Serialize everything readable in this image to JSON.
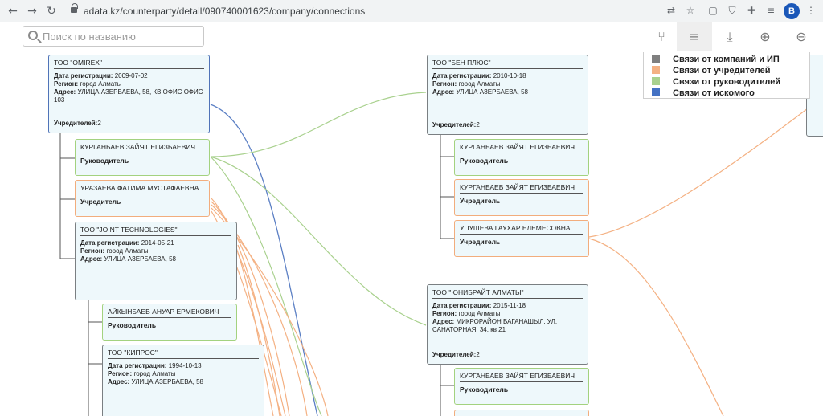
{
  "browser": {
    "url": "adata.kz/counterparty/detail/090740001623/company/connections",
    "profile_initial": "B",
    "back_icon": "arrow-left",
    "forward_icon": "arrow-right",
    "reload_icon": "reload"
  },
  "toolbar": {
    "search_placeholder": "Поиск по названию",
    "buttons": [
      "tree-icon",
      "list-icon",
      "download-icon",
      "zoom-in-icon",
      "zoom-out-icon"
    ]
  },
  "legend": [
    {
      "label": "Связи от компаний и ИП",
      "color": "#7f7f7f"
    },
    {
      "label": "Связи от учредителей",
      "color": "#f4b183"
    },
    {
      "label": "Связи от руководителей",
      "color": "#a9d18e"
    },
    {
      "label": "Связи от искомого",
      "color": "#4472c4"
    }
  ],
  "labels": {
    "reg": "Дата регистрации:",
    "region": "Регион:",
    "address": "Адрес:",
    "founders": "Учредителей:"
  },
  "nodes": {
    "omirex": {
      "title": "ТОО \"OMIREX\"",
      "reg_date": "2009-07-02",
      "region": "город Алматы",
      "address": "УЛИЦА АЗЕРБАЕВА, 58, КВ ОФИС ОФИС 103",
      "founders_count": "2"
    },
    "kurganbaev_1": {
      "name": "КУРГАНБАЕВ ЗАЙЯТ ЕГИЗБАЕВИЧ",
      "role": "Руководитель"
    },
    "urazaeva": {
      "name": "УРАЗАЕВА ФАТИМА МУСТАФАЕВНА",
      "role": "Учредитель"
    },
    "joint": {
      "title": "ТОО \"JOINT TECHNOLOGIES\"",
      "reg_date": "2014-05-21",
      "region": "город Алматы",
      "address": "УЛИЦА АЗЕРБАЕВА, 58"
    },
    "aikynbaev": {
      "name": "АЙКЫНБАЕВ АНУАР ЕРМЕКОВИЧ",
      "role": "Руководитель"
    },
    "kipros": {
      "title": "ТОО \"КИПРОС\"",
      "reg_date": "1994-10-13",
      "region": "город Алматы",
      "address": "УЛИЦА АЗЕРБАЕВА, 58"
    },
    "ben_plus": {
      "title": "ТОО \"БЕН ПЛЮС\"",
      "reg_date": "2010-10-18",
      "region": "город Алматы",
      "address": "УЛИЦА АЗЕРБАЕВА, 58",
      "founders_count": "2"
    },
    "kurganbaev_2": {
      "name": "КУРГАНБАЕВ ЗАЙЯТ ЕГИЗБАЕВИЧ",
      "role": "Руководитель"
    },
    "kurganbaev_3": {
      "name": "КУРГАНБАЕВ ЗАЙЯТ ЕГИЗБАЕВИЧ",
      "role": "Учредитель"
    },
    "upusheva": {
      "name": "УПУШЕВА ГАУХАР ЕЛЕМЕСОВНА",
      "role": "Учредитель"
    },
    "unibright": {
      "title": "ТОО \"ЮНИБРАЙТ АЛМАТЫ\"",
      "reg_date": "2015-11-18",
      "region": "город Алматы",
      "address": "МИКРОРАЙОН БАГАНАШЫЛ, УЛ. САНАТОРНАЯ, 34, кв 21",
      "founders_count": "2"
    },
    "kurganbaev_4": {
      "name": "КУРГАНБАЕВ ЗАЙЯТ ЕГИЗБАЕВИЧ",
      "role": "Руководитель"
    }
  }
}
